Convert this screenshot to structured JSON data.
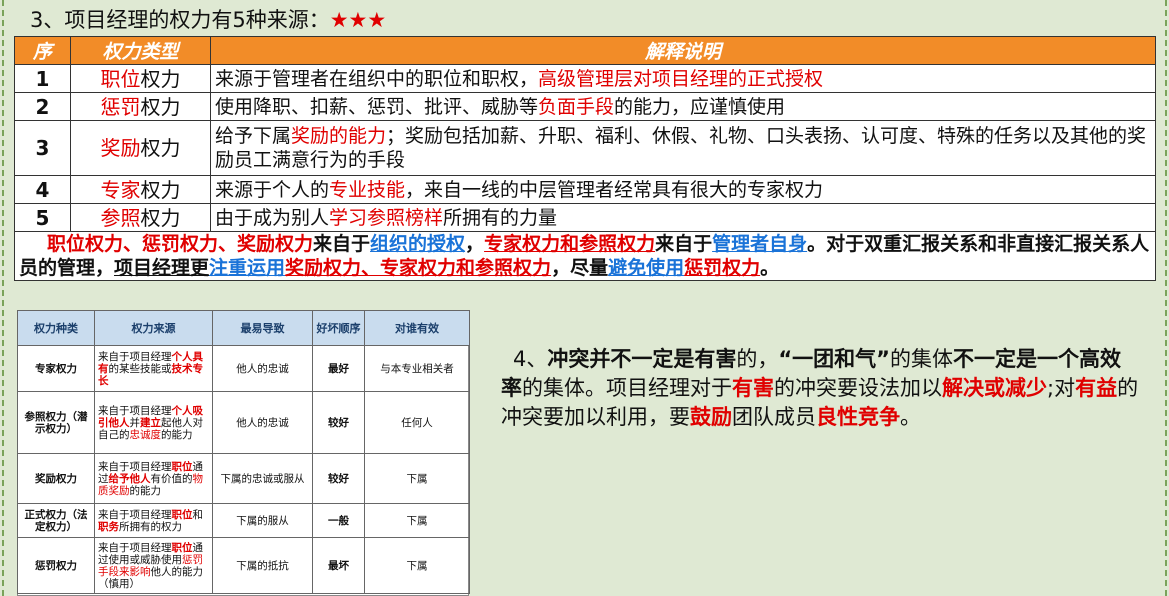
{
  "title": {
    "text": "3、项目经理的权力有5种来源：",
    "stars": "★★★"
  },
  "power_table": {
    "headers": [
      "序",
      "权力类型",
      "解释说明"
    ],
    "rows": [
      {
        "num": "1",
        "type_red": "职位",
        "type_rest": "权力",
        "desc_a": "来源于管理者在组织中的职位和职权，",
        "desc_red": "高级管理层对项目经理的正式授权",
        "desc_b": ""
      },
      {
        "num": "2",
        "type_red": "惩罚",
        "type_rest": "权力",
        "desc_a": "使用降职、扣薪、惩罚、批评、威胁等",
        "desc_red": "负面手段",
        "desc_b": "的能力，应谨慎使用"
      },
      {
        "num": "3",
        "type_red": "奖励",
        "type_rest": "权力",
        "desc_a": "给予下属",
        "desc_red": "奖励的能力",
        "desc_b": "；奖励包括加薪、升职、福利、休假、礼物、口头表扬、认可度、特殊的任务以及其他的奖励员工满意行为的手段"
      },
      {
        "num": "4",
        "type_red": "专家",
        "type_rest": "权力",
        "desc_a": "来源于个人的",
        "desc_red": "专业技能",
        "desc_b": "，来自一线的中层管理者经常具有很大的专家权力"
      },
      {
        "num": "5",
        "type_red": "参照",
        "type_rest": "权力",
        "desc_a": "由于成为别人",
        "desc_red": "学习参照榜样",
        "desc_b": "所拥有的力量"
      }
    ],
    "summary": {
      "s1": "职位权力、惩罚权力、奖励权力",
      "s2": "来自于",
      "s3": "组织的授权",
      "s4": "，",
      "s5": "专家权力和参照权力",
      "s6": "来自于",
      "s7": "管理者自身",
      "s8": "。对于双重汇报关系和非直接汇报关系人员的管理，",
      "s9": "项目经理更",
      "s10": "注重运用",
      "s11": "奖励权力、专家权力和参照权力",
      "s12": "，尽量",
      "s13": "避免使用",
      "s14": "惩罚权力",
      "s15": "。"
    }
  },
  "small_table": {
    "headers": [
      "权力种类",
      "权力来源",
      "最易导致",
      "好坏顺序",
      "对谁有效"
    ],
    "rows": [
      {
        "kind": "专家权力",
        "src": [
          "来自于项目经理",
          "个人具有",
          "的某些技能或",
          "技术专长",
          ""
        ],
        "result": "他人的忠诚",
        "rank": "最好",
        "target": "与本专业相关者"
      },
      {
        "kind": "参照权力（潜示权力）",
        "src": [
          "来自于项目经理",
          "个人吸引他人",
          "并",
          "建立",
          "起他人对自己的",
          "忠诚度",
          "的能力"
        ],
        "result": "他人的忠诚",
        "rank": "较好",
        "target": "任何人"
      },
      {
        "kind": "奖励权力",
        "src": [
          "来自于项目经理",
          "职位",
          "通过",
          "给予他人",
          "有价值的",
          "物质奖励",
          "的能力"
        ],
        "result": "下属的忠诚或服从",
        "rank": "较好",
        "target": "下属"
      },
      {
        "kind": "正式权力（法定权力）",
        "src": [
          "来自于项目经理",
          "职位",
          "和",
          "职务",
          "所拥有的权力"
        ],
        "result": "下属的服从",
        "rank": "一般",
        "target": "下属"
      },
      {
        "kind": "惩罚权力",
        "src": [
          "来自于项目经理",
          "职位",
          "通过使用或威胁使用",
          "惩罚手段来影响",
          "他人的能力（慎用）"
        ],
        "result": "下属的抵抗",
        "rank": "最坏",
        "target": "下属"
      }
    ]
  },
  "conflict": {
    "t1": "4、",
    "t2": "冲突并不一定是有害",
    "t3": "的，",
    "t4": "“一团和气”",
    "t5": "的集体",
    "t6": "不一定是一个高效率",
    "t7": "的集体。项目经理对于",
    "t8": "有害",
    "t9": "的冲突要设法加以",
    "t10": "解决或减少",
    "t11": ";对",
    "t12": "有益",
    "t13": "的冲突要加以利用，要",
    "t14": "鼓励",
    "t15": "团队成员",
    "t16": "良性竞争",
    "t17": "。"
  }
}
